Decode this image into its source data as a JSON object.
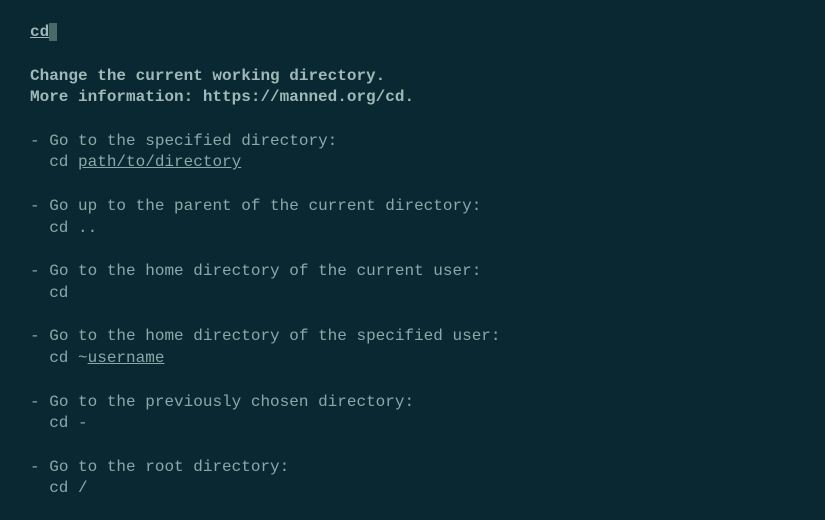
{
  "title": "cd",
  "description_line1": "Change the current working directory.",
  "description_line2": "More information: https://manned.org/cd.",
  "examples": [
    {
      "desc": "Go to the specified directory:",
      "cmd_prefix": "cd ",
      "placeholder": "path/to/directory",
      "cmd_suffix": ""
    },
    {
      "desc": "Go up to the parent of the current directory:",
      "cmd_prefix": "cd ..",
      "placeholder": "",
      "cmd_suffix": ""
    },
    {
      "desc": "Go to the home directory of the current user:",
      "cmd_prefix": "cd",
      "placeholder": "",
      "cmd_suffix": ""
    },
    {
      "desc": "Go to the home directory of the specified user:",
      "cmd_prefix": "cd ~",
      "placeholder": "username",
      "cmd_suffix": ""
    },
    {
      "desc": "Go to the previously chosen directory:",
      "cmd_prefix": "cd -",
      "placeholder": "",
      "cmd_suffix": ""
    },
    {
      "desc": "Go to the root directory:",
      "cmd_prefix": "cd /",
      "placeholder": "",
      "cmd_suffix": ""
    }
  ],
  "bullet": "-"
}
